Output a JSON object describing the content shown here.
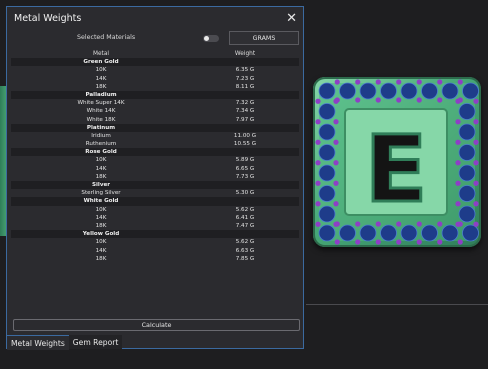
{
  "window": {
    "title": "Metal Weights",
    "close_glyph": "✕"
  },
  "controls": {
    "selected_materials_label": "Selected Materials",
    "toggle_on": false,
    "unit_button_label": "GRAMS"
  },
  "table": {
    "headers": {
      "metal": "Metal",
      "weight": "Weight"
    },
    "groups": [
      {
        "name": "Green Gold",
        "items": [
          {
            "metal": "10K",
            "weight": "6.35 G"
          },
          {
            "metal": "14K",
            "weight": "7.23 G"
          },
          {
            "metal": "18K",
            "weight": "8.11 G"
          }
        ]
      },
      {
        "name": "Palladium",
        "items": [
          {
            "metal": "White Super 14K",
            "weight": "7.32 G"
          },
          {
            "metal": "White 14K",
            "weight": "7.34 G"
          },
          {
            "metal": "White 18K",
            "weight": "7.97 G"
          }
        ]
      },
      {
        "name": "Platinum",
        "items": [
          {
            "metal": "Iridium",
            "weight": "11.00 G"
          },
          {
            "metal": "Ruthenium",
            "weight": "10.55 G"
          }
        ]
      },
      {
        "name": "Rose Gold",
        "items": [
          {
            "metal": "10K",
            "weight": "5.89 G"
          },
          {
            "metal": "14K",
            "weight": "6.65 G"
          },
          {
            "metal": "18K",
            "weight": "7.73 G"
          }
        ]
      },
      {
        "name": "Silver",
        "items": [
          {
            "metal": "Sterling Silver",
            "weight": "5.30 G"
          }
        ]
      },
      {
        "name": "White Gold",
        "items": [
          {
            "metal": "10K",
            "weight": "5.62 G"
          },
          {
            "metal": "14K",
            "weight": "6.41 G"
          },
          {
            "metal": "18K",
            "weight": "7.47 G"
          }
        ]
      },
      {
        "name": "Yellow Gold",
        "items": [
          {
            "metal": "10K",
            "weight": "5.62 G"
          },
          {
            "metal": "14K",
            "weight": "6.63 G"
          },
          {
            "metal": "18K",
            "weight": "7.85 G"
          }
        ]
      }
    ]
  },
  "actions": {
    "calculate_label": "Calculate"
  },
  "tabs": [
    {
      "label": "Metal Weights",
      "active": true
    },
    {
      "label": "Gem Report",
      "active": false
    }
  ],
  "viewport": {
    "letter": "E",
    "colors": {
      "metal_green": "#4aa777",
      "sapphire_blue": "#1e3c8a",
      "amethyst_purple": "#8e3fc6"
    }
  }
}
